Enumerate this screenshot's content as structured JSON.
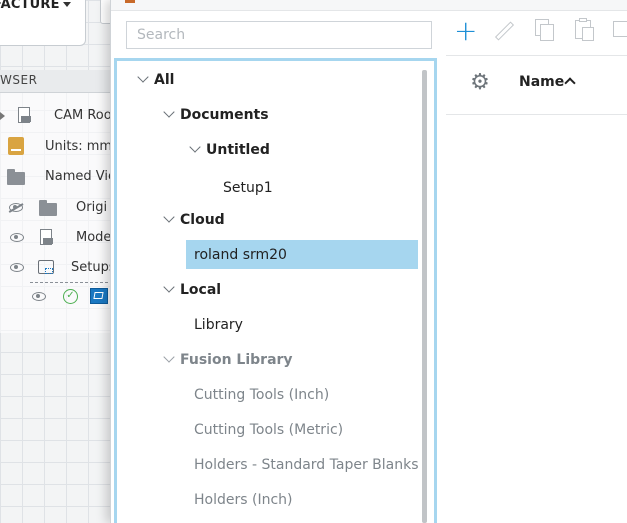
{
  "workspace": {
    "tab_label": "FACTURE",
    "browser_title": "WSER",
    "browser_items": [
      {
        "label": "CAM Roo"
      },
      {
        "label": "Units: mm"
      },
      {
        "label": "Named Vie"
      },
      {
        "label": "Origi"
      },
      {
        "label": "Mode"
      },
      {
        "label": "Setups"
      }
    ]
  },
  "dialog": {
    "search_placeholder": "Search",
    "tree": [
      {
        "label": "All"
      },
      {
        "label": "Documents"
      },
      {
        "label": "Untitled"
      },
      {
        "label": "Setup1"
      },
      {
        "label": "Cloud"
      },
      {
        "label": "roland srm20"
      },
      {
        "label": "Local"
      },
      {
        "label": "Library"
      },
      {
        "label": "Fusion Library"
      },
      {
        "label": "Cutting Tools (Inch)"
      },
      {
        "label": "Cutting Tools (Metric)"
      },
      {
        "label": "Holders - Standard Taper Blanks"
      },
      {
        "label": "Holders (Inch)"
      }
    ],
    "selected_item": "roland srm20",
    "table": {
      "name_column": "Name",
      "sort": "ascending"
    },
    "toolbar_icons": [
      "plus-icon",
      "pencil-icon",
      "copy-icon",
      "paste-icon",
      "duplicate-icon"
    ],
    "colors": {
      "accent": "#1e8fd6",
      "selection": "#a6d6ef",
      "muted_text": "#7e858b"
    }
  }
}
